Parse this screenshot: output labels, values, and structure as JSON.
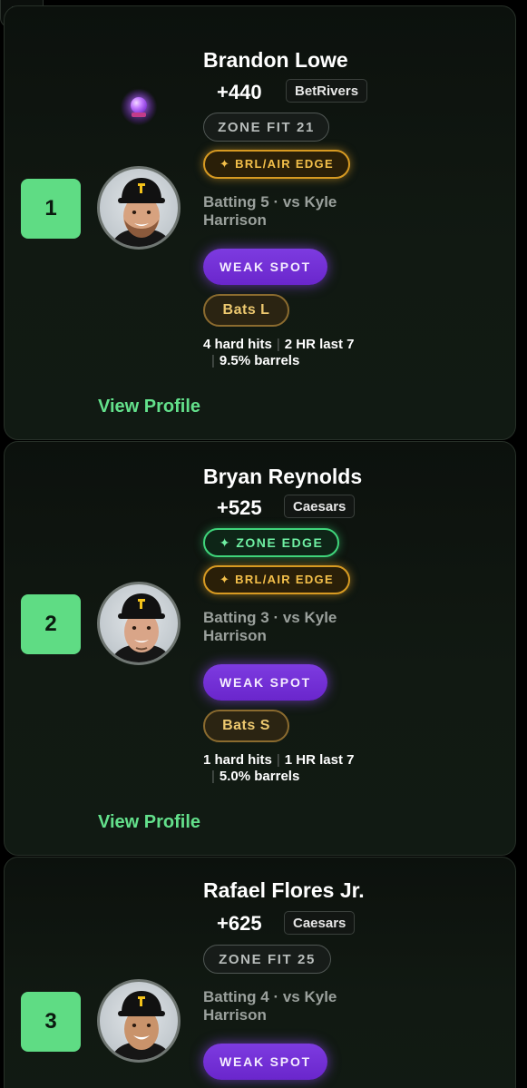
{
  "cards": [
    {
      "rank": "1",
      "name": "Brandon Lowe",
      "odds": "+440",
      "sportsbook": "BetRivers",
      "zone_fit": "ZONE FIT 21",
      "edge_badges": [
        "✦ BRL/AIR EDGE"
      ],
      "batting": "Batting 5 · vs Kyle Harrison",
      "weak_spot": "WEAK SPOT",
      "bats": "Bats L",
      "stats": {
        "hard_hits": "4 hard hits",
        "hr_last7": "2 HR last 7",
        "barrels": "9.5% barrels"
      },
      "view_profile": "View Profile"
    },
    {
      "rank": "2",
      "name": "Bryan Reynolds",
      "odds": "+525",
      "sportsbook": "Caesars",
      "zone_edge": "✦ ZONE EDGE",
      "edge_badges": [
        "✦ BRL/AIR EDGE"
      ],
      "batting": "Batting 3 · vs Kyle Harrison",
      "weak_spot": "WEAK SPOT",
      "bats": "Bats S",
      "stats": {
        "hard_hits": "1 hard hits",
        "hr_last7": "1 HR last 7",
        "barrels": "5.0% barrels"
      },
      "view_profile": "View Profile"
    },
    {
      "rank": "3",
      "name": "Rafael Flores Jr.",
      "odds": "+625",
      "sportsbook": "Caesars",
      "zone_fit": "ZONE FIT 25",
      "batting": "Batting 4 · vs Kyle Harrison",
      "weak_spot": "WEAK SPOT"
    }
  ],
  "icons": {
    "menu": "menu-icon",
    "orb": "crystal-ball-icon",
    "avatar": "player-headshot"
  },
  "colors": {
    "accent_green": "#5fdc84",
    "weak_purple": "#7d3be0",
    "brl_gold": "#d79a22",
    "zone_edge_green": "#3fd57b"
  }
}
